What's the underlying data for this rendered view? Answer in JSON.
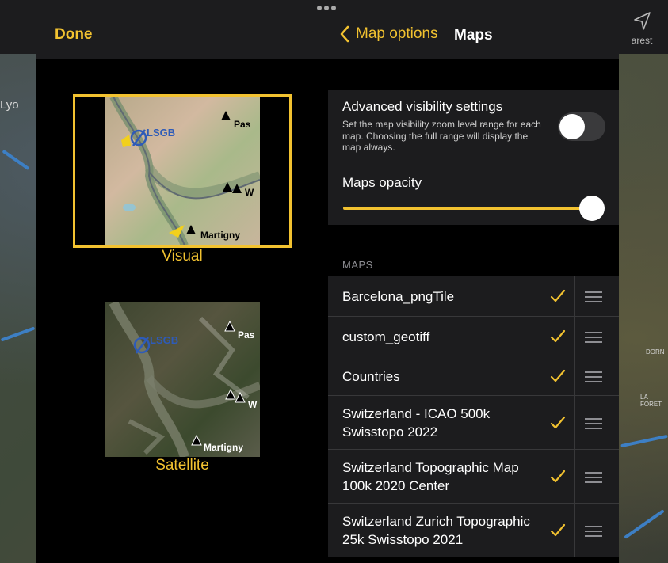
{
  "background": {
    "city_label": "Lyo",
    "right_labels": [
      "DORN",
      "LA FORET"
    ],
    "nearest_label": "arest"
  },
  "header": {
    "done_label": "Done",
    "back_label": "Map options",
    "title": "Maps"
  },
  "map_styles": [
    {
      "label": "Visual",
      "selected": true,
      "airport": "LSGB",
      "places": [
        "Pas",
        "W",
        "Martigny"
      ]
    },
    {
      "label": "Satellite",
      "selected": false,
      "airport": "LSGB",
      "places": [
        "Pas",
        "W",
        "Martigny"
      ]
    }
  ],
  "settings": {
    "advanced_title": "Advanced visibility settings",
    "advanced_description": "Set the map visibility zoom level range for each map. Choosing the full range will display the map always.",
    "advanced_enabled": false,
    "opacity_title": "Maps opacity",
    "opacity_value": 1.0
  },
  "maps_section": {
    "header": "MAPS",
    "items": [
      {
        "name": "Barcelona_pngTile",
        "checked": true
      },
      {
        "name": "custom_geotiff",
        "checked": true
      },
      {
        "name": "Countries",
        "checked": true
      },
      {
        "name": "Switzerland - ICAO 500k Swisstopo 2022",
        "checked": true
      },
      {
        "name": "Switzerland Topographic Map 100k 2020 Center",
        "checked": true
      },
      {
        "name": "Switzerland Zurich Topographic 25k Swisstopo 2021",
        "checked": true
      }
    ]
  },
  "colors": {
    "accent": "#f2c230",
    "panel": "#1c1c1e",
    "background": "#000000"
  }
}
